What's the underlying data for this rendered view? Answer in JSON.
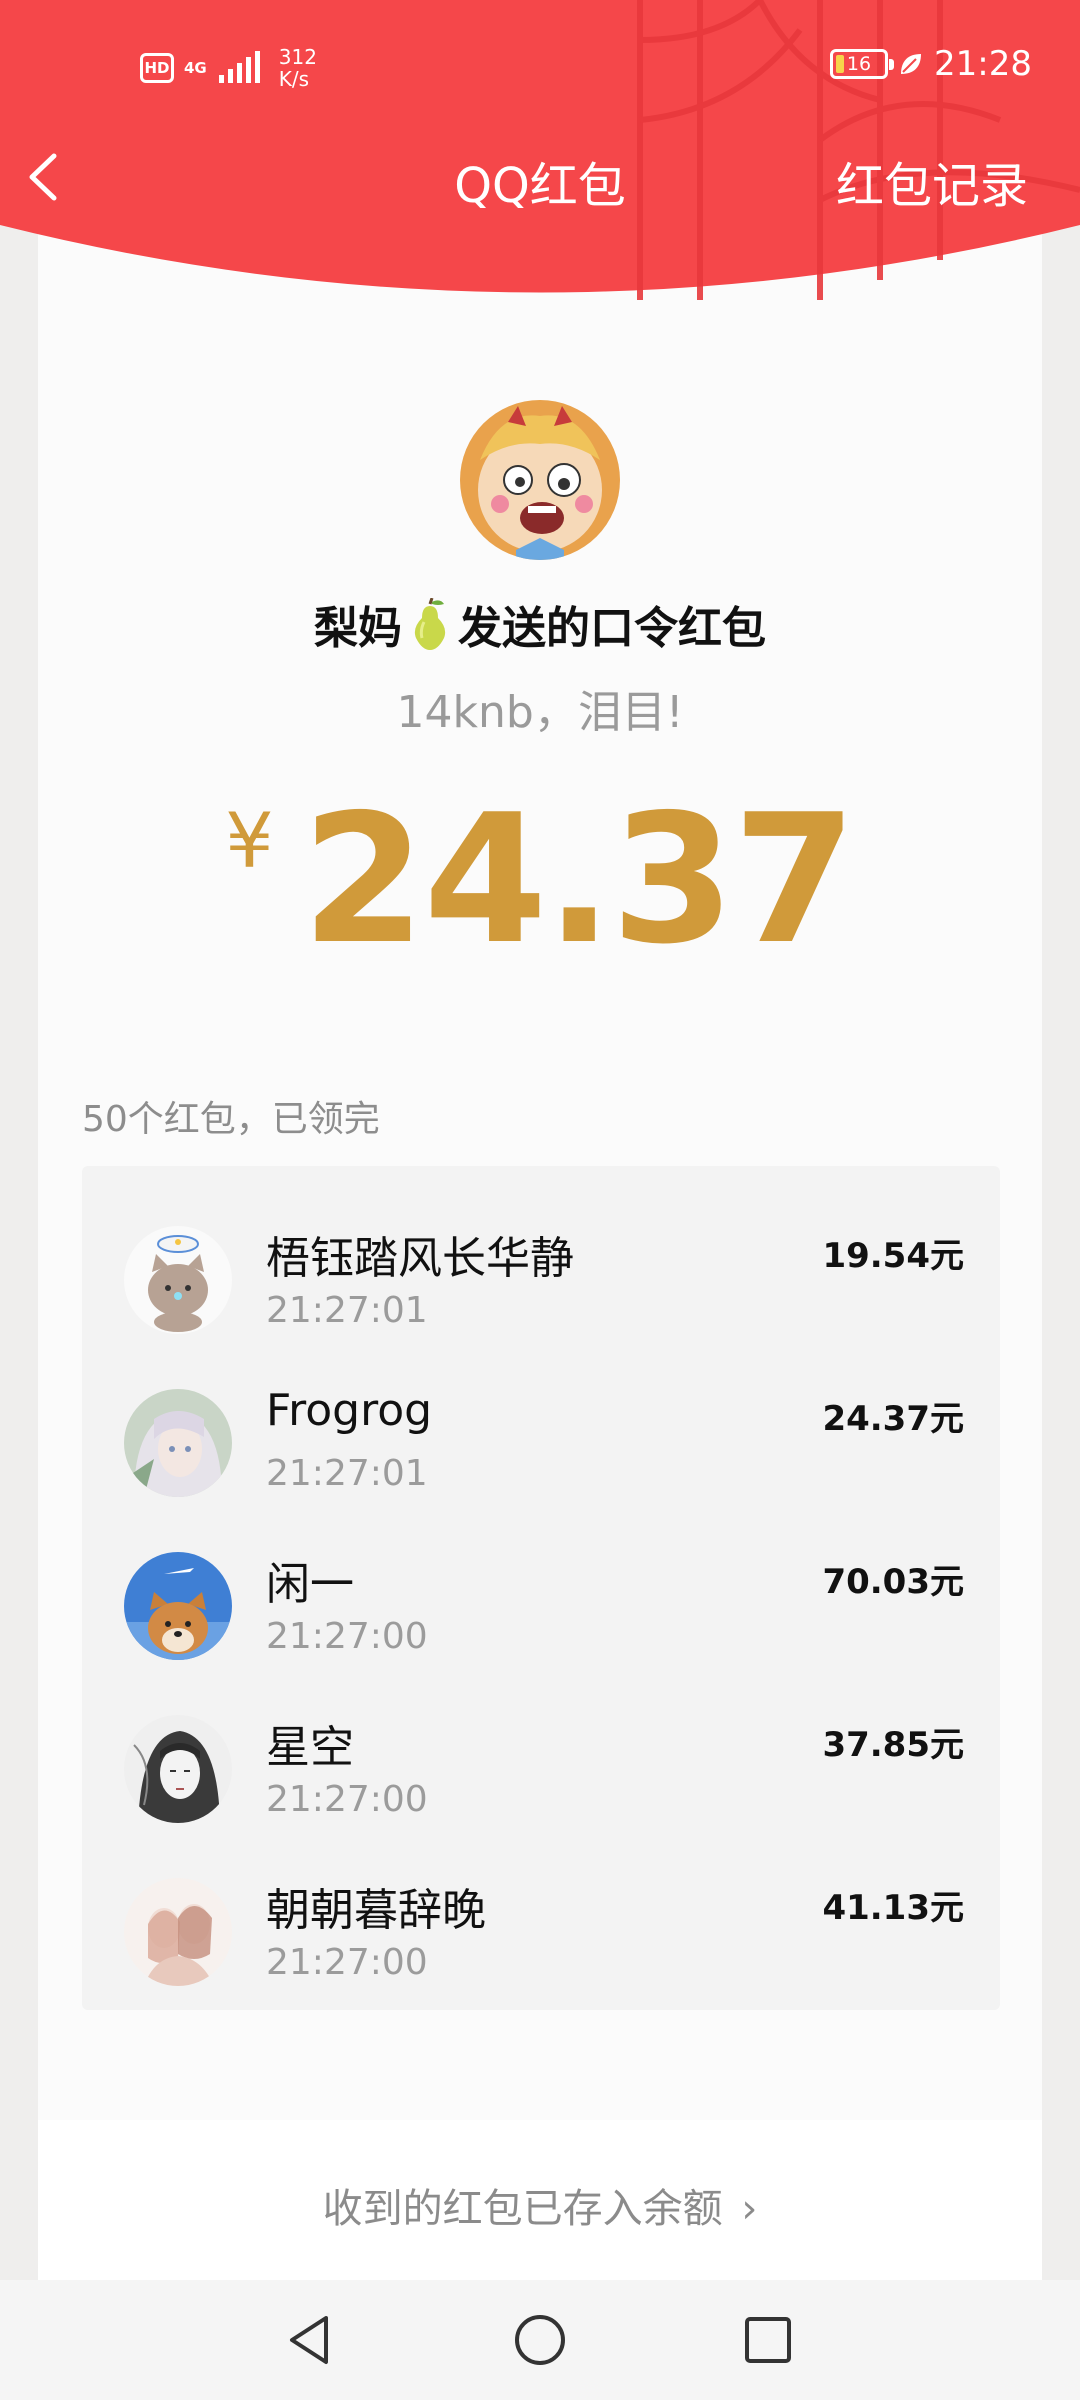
{
  "status_bar": {
    "hd": "HD",
    "network": "4G",
    "speed_value": "312",
    "speed_unit": "K/s",
    "battery": "16",
    "time": "21:28"
  },
  "nav": {
    "title": "QQ红包",
    "records": "红包记录",
    "back_icon": "chevron-left-icon"
  },
  "packet": {
    "sender": "梨妈",
    "sender_suffix": "发送的口令红包",
    "message": "14knb，泪目!",
    "currency": "¥",
    "amount": "24.37"
  },
  "summary": "50个红包，已领完",
  "records": [
    {
      "name": "梧钰踏风长华静",
      "time": "21:27:01",
      "amount": "19.54元"
    },
    {
      "name": "Frogrog",
      "time": "21:27:01",
      "amount": "24.37元"
    },
    {
      "name": "闲一",
      "time": "21:27:00",
      "amount": "70.03元"
    },
    {
      "name": "星空",
      "time": "21:27:00",
      "amount": "37.85元"
    },
    {
      "name": "朝朝暮辞晚",
      "time": "21:27:00",
      "amount": "41.13元"
    }
  ],
  "footer": {
    "link": "收到的红包已存入余额",
    "chevron": "›"
  },
  "colors": {
    "header_red": "#f5474a",
    "gold": "#d09a3a",
    "list_bg": "#f3f3f3"
  }
}
